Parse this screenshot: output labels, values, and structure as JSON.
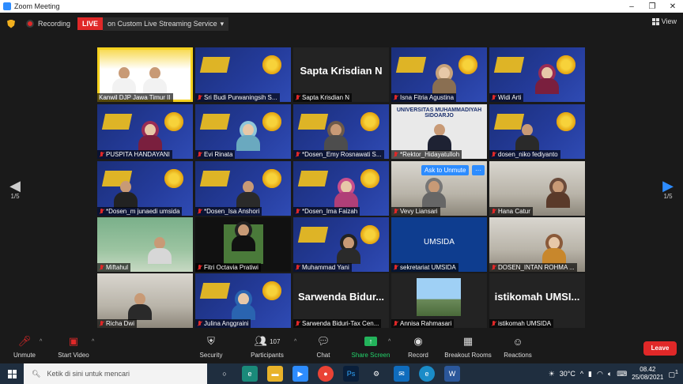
{
  "window": {
    "title": "Zoom Meeting"
  },
  "topbar": {
    "recording_label": "Recording",
    "live_badge": "LIVE",
    "live_service": "on Custom Live Streaming Service",
    "view_label": "View"
  },
  "tiles": [
    {
      "name": "Kanwil DJP Jawa Timur II",
      "muted": false
    },
    {
      "name": "Sri Budi Purwaningsih S...",
      "muted": true
    },
    {
      "name": "Sapta Krisdian N",
      "muted": true,
      "big_name": "Sapta Krisdian N"
    },
    {
      "name": "Isna Fitria Agustina",
      "muted": true
    },
    {
      "name": "Widi Arti",
      "muted": true
    },
    {
      "name": "PUSPITA HANDAYANI",
      "muted": true
    },
    {
      "name": "Evi Rinata",
      "muted": true
    },
    {
      "name": "*Dosen_Emy Rosnawati S...",
      "muted": true
    },
    {
      "name": "*Rektor_Hidayatulloh",
      "muted": true,
      "banner": "UNIVERSITAS MUHAMMADIYAH SIDOARJO"
    },
    {
      "name": "dosen_niko fediyanto",
      "muted": true
    },
    {
      "name": "*Dosen_m junaedi umsida",
      "muted": true
    },
    {
      "name": "*Dosen_Isa Anshori",
      "muted": true
    },
    {
      "name": "*Dosen_Ima Faizah",
      "muted": true
    },
    {
      "name": "Vevy Liansari",
      "muted": true,
      "ask_unmute": "Ask to Unmute",
      "more": "···"
    },
    {
      "name": "Hana Catur",
      "muted": true
    },
    {
      "name": "Miftahul",
      "muted": true
    },
    {
      "name": "Fitri Octavia Pratiwi",
      "muted": true
    },
    {
      "name": "Muhammad Yani",
      "muted": true
    },
    {
      "name": "sekretariat UMSIDA",
      "muted": true,
      "logo_text": "UMSIDA"
    },
    {
      "name": "DOSEN_INTAN ROHMA ...",
      "muted": true
    },
    {
      "name": "Richa Dwi",
      "muted": true
    },
    {
      "name": "Julina Anggraini",
      "muted": true
    },
    {
      "name": "Sarwenda Biduri-Tax Cen...",
      "muted": true,
      "big_name": "Sarwenda Bidur..."
    },
    {
      "name": "Annisa Rahmasari",
      "muted": true
    },
    {
      "name": "istikomah UMSIDA",
      "muted": true,
      "big_name": "istikomah UMSI..."
    }
  ],
  "pagination": {
    "left": "1/5",
    "right": "1/5"
  },
  "toolbar": {
    "unmute": "Unmute",
    "start_video": "Start Video",
    "security": "Security",
    "participants": "Participants",
    "participants_count": "107",
    "chat": "Chat",
    "share_screen": "Share Screen",
    "record": "Record",
    "breakout_rooms": "Breakout Rooms",
    "reactions": "Reactions",
    "leave": "Leave"
  },
  "taskbar": {
    "search_placeholder": "Ketik di sini untuk mencari",
    "temperature": "30°C",
    "time": "08.42",
    "date": "25/08/2021",
    "notification_count": "1"
  },
  "colors": {
    "accent": "#2d8cff",
    "live": "#e02828",
    "active_speaker": "#f6d21e",
    "share_green": "#23b35b"
  }
}
